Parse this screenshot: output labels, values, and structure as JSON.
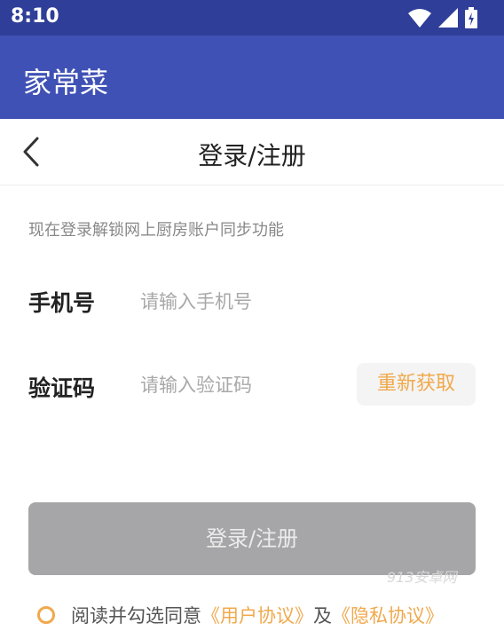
{
  "status_bar": {
    "time": "8:10"
  },
  "app_bar": {
    "title": "家常菜"
  },
  "header": {
    "title": "登录/注册"
  },
  "subtitle": "现在登录解锁网上厨房账户同步功能",
  "phone": {
    "label": "手机号",
    "placeholder": "请输入手机号"
  },
  "code": {
    "label": "验证码",
    "placeholder": "请输入验证码",
    "resend_label": "重新获取"
  },
  "login_button": "登录/注册",
  "watermark": "913安卓网",
  "agreement": {
    "prefix": "阅读并勾选同意",
    "user_link": "《用户协议》",
    "and": "及",
    "privacy_link": "《隐私协议》"
  },
  "colors": {
    "status_bar": "#2f3e99",
    "app_bar": "#3f51b5",
    "accent": "#f0a94d",
    "button_disabled": "#a6a5a7"
  }
}
